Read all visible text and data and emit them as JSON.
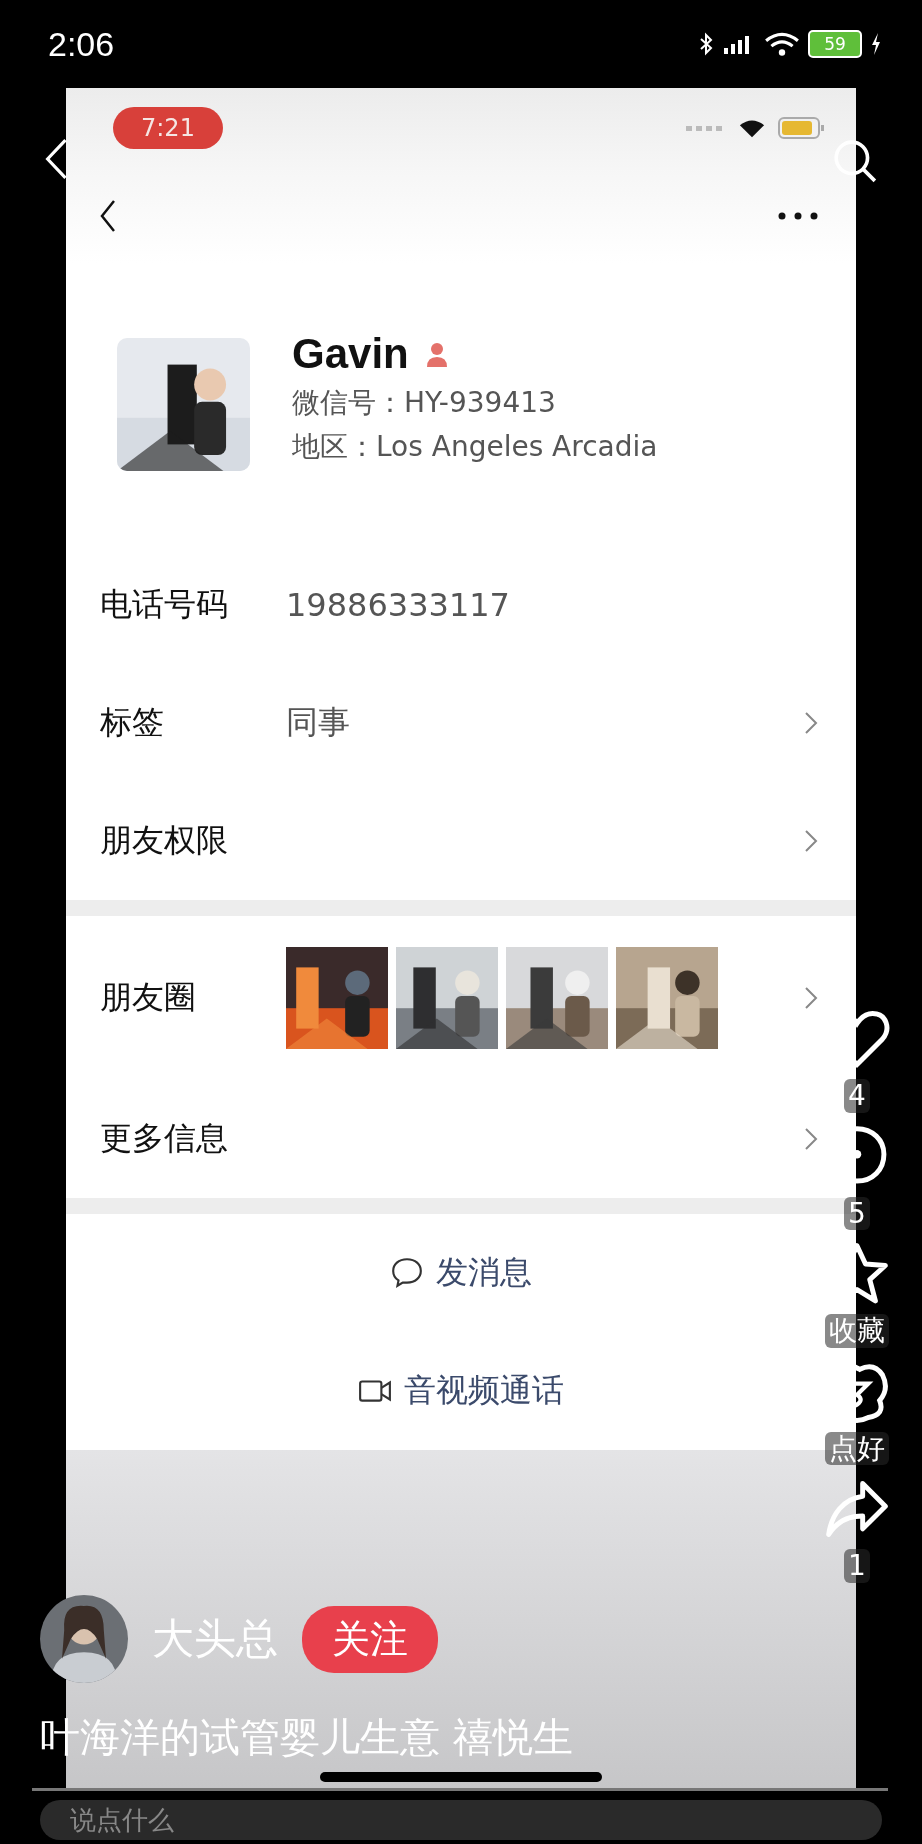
{
  "status_bar": {
    "time": "2:06",
    "battery": "59"
  },
  "video": {
    "inner_status": {
      "time": "7:21"
    },
    "profile": {
      "name": "Gavin",
      "wechat_id": "微信号：HY-939413",
      "region": "地区：Los Angeles Arcadia"
    },
    "info_rows": [
      {
        "label": "电话号码",
        "value": "19886333117",
        "chevron": false
      },
      {
        "label": "标签",
        "value": "同事",
        "chevron": true
      },
      {
        "label": "朋友权限",
        "chevron": true
      }
    ],
    "more_rows": [
      {
        "label": "朋友圈",
        "kind": "photos",
        "chevron": true
      },
      {
        "label": "更多信息",
        "kind": "plain",
        "chevron": true
      }
    ],
    "actions": [
      {
        "kind": "message",
        "label": "发消息"
      },
      {
        "kind": "call",
        "label": "音视频通话"
      }
    ]
  },
  "side_actions": [
    {
      "kind": "heart",
      "text": "4"
    },
    {
      "kind": "comment",
      "text": "5"
    },
    {
      "kind": "star",
      "text": "收藏"
    },
    {
      "kind": "sticker",
      "text": "点好"
    },
    {
      "kind": "share",
      "text": "1"
    }
  ],
  "author": {
    "name": "大头总",
    "follow": "关注"
  },
  "caption": "叶海洋的试管婴儿生意 禧悦生",
  "comment_bar": {
    "placeholder": "说点什么"
  }
}
